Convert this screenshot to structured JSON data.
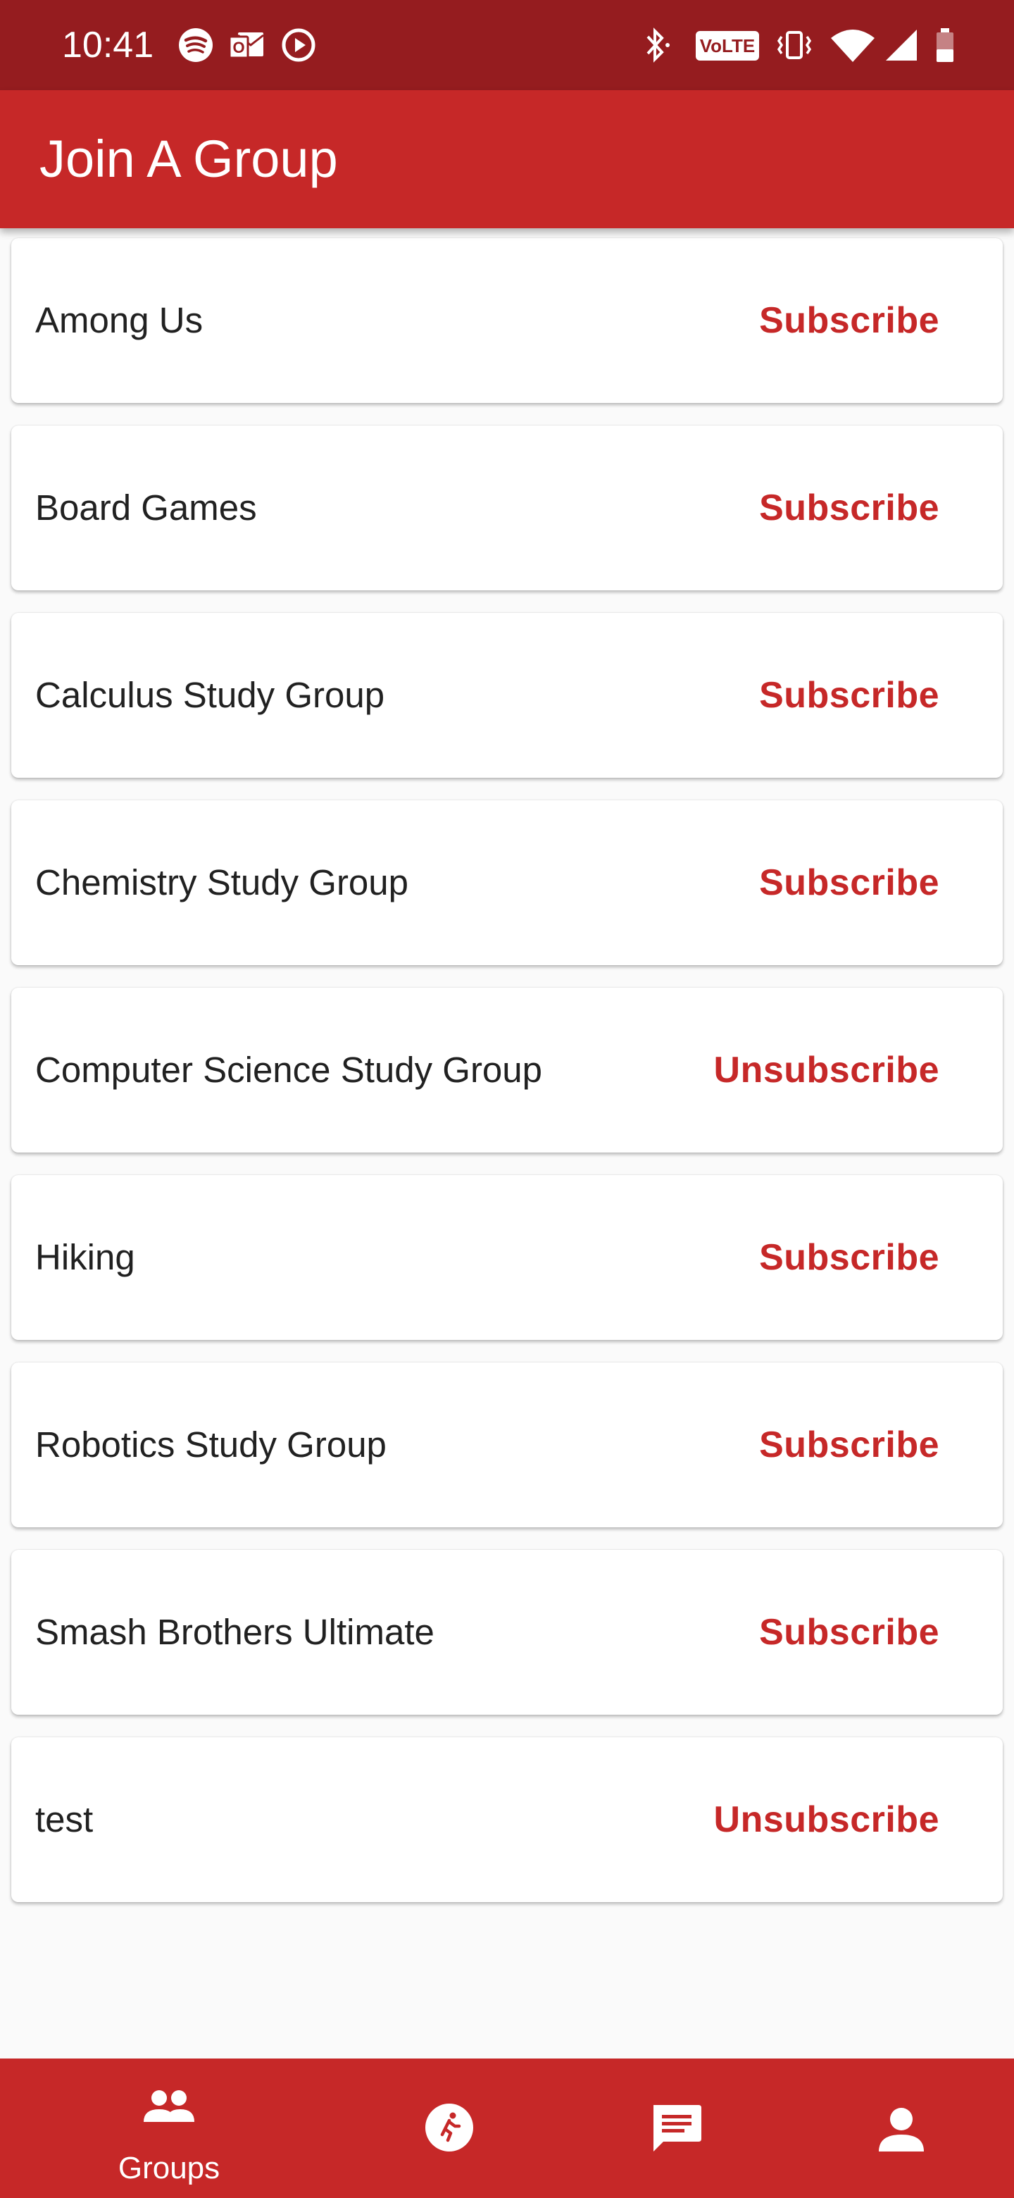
{
  "status_bar": {
    "time": "10:41",
    "left_icons": [
      "spotify-icon",
      "outlook-icon",
      "play-icon"
    ],
    "right_icons": [
      "bluetooth-icon",
      "volte-icon",
      "vibrate-icon",
      "wifi-icon",
      "signal-icon",
      "battery-icon"
    ],
    "volte_text": "VoLTE"
  },
  "app_bar": {
    "title": "Join A Group"
  },
  "colors": {
    "primary": "#c62828",
    "status_bar": "#951c1f",
    "background": "#fafafa",
    "card": "#ffffff",
    "text": "#212121"
  },
  "groups": [
    {
      "name": "Among Us",
      "action": "Subscribe"
    },
    {
      "name": "Board Games",
      "action": "Subscribe"
    },
    {
      "name": "Calculus Study Group",
      "action": "Subscribe"
    },
    {
      "name": "Chemistry Study Group",
      "action": "Subscribe"
    },
    {
      "name": "Computer Science Study Group",
      "action": "Unsubscribe"
    },
    {
      "name": "Hiking",
      "action": "Subscribe"
    },
    {
      "name": "Robotics Study Group",
      "action": "Subscribe"
    },
    {
      "name": "Smash Brothers Ultimate",
      "action": "Subscribe"
    },
    {
      "name": "test",
      "action": "Unsubscribe"
    }
  ],
  "bottom_nav": {
    "items": [
      {
        "icon": "groups-icon",
        "label": "Groups",
        "active": true
      },
      {
        "icon": "activity-icon",
        "label": ""
      },
      {
        "icon": "chat-icon",
        "label": ""
      },
      {
        "icon": "profile-icon",
        "label": ""
      }
    ]
  }
}
